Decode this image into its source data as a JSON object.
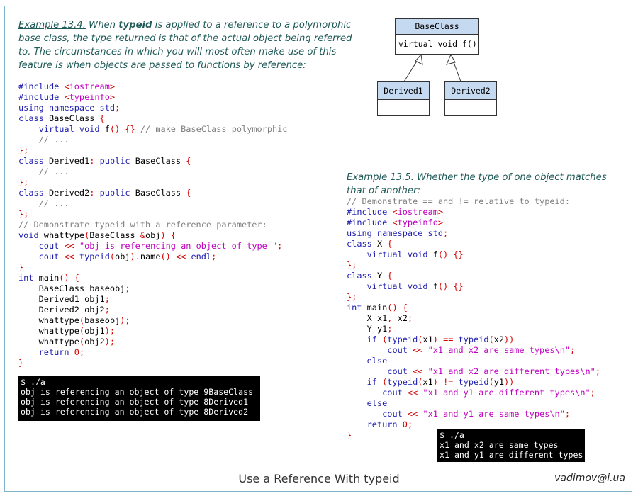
{
  "example1": {
    "label": "Example 13.4.",
    "text_a": " When ",
    "keyword": "typeid",
    "text_b": " is applied to a reference to a polymorphic base class, the type returned is that of the actual object being referred to. The circumstances in which you will most often make use of this feature is when objects are passed to functions by reference:"
  },
  "code1": [
    [
      [
        "#include ",
        "k"
      ],
      [
        "<",
        "p"
      ],
      [
        "iostream",
        "s"
      ],
      [
        ">",
        "p"
      ]
    ],
    [
      [
        "#include ",
        "k"
      ],
      [
        "<",
        "p"
      ],
      [
        "typeinfo",
        "s"
      ],
      [
        ">",
        "p"
      ]
    ],
    [
      [
        "using namespace std",
        "k"
      ],
      [
        ";",
        "p"
      ]
    ],
    [
      [
        "class ",
        "k"
      ],
      [
        "BaseClass ",
        ""
      ],
      [
        "{",
        "p"
      ]
    ],
    [
      [
        "    ",
        ""
      ],
      [
        "virtual void ",
        "k"
      ],
      [
        "f",
        ""
      ],
      [
        "() {} ",
        "p"
      ],
      [
        "// make BaseClass polymorphic",
        "c"
      ]
    ],
    [
      [
        "    ",
        ""
      ],
      [
        "// ...",
        "c"
      ]
    ],
    [
      [
        "};",
        "p"
      ]
    ],
    [
      [
        "class ",
        "k"
      ],
      [
        "Derived1",
        ""
      ],
      [
        ": ",
        "p"
      ],
      [
        "public ",
        "k"
      ],
      [
        "BaseClass ",
        ""
      ],
      [
        "{",
        "p"
      ]
    ],
    [
      [
        "    ",
        ""
      ],
      [
        "// ...",
        "c"
      ]
    ],
    [
      [
        "};",
        "p"
      ]
    ],
    [
      [
        "class ",
        "k"
      ],
      [
        "Derived2",
        ""
      ],
      [
        ": ",
        "p"
      ],
      [
        "public ",
        "k"
      ],
      [
        "BaseClass ",
        ""
      ],
      [
        "{",
        "p"
      ]
    ],
    [
      [
        "    ",
        ""
      ],
      [
        "// ...",
        "c"
      ]
    ],
    [
      [
        "};",
        "p"
      ]
    ],
    [
      [
        "// Demonstrate typeid with a reference parameter:",
        "c"
      ]
    ],
    [
      [
        "void ",
        "k"
      ],
      [
        "whattype",
        ""
      ],
      [
        "(",
        "p"
      ],
      [
        "BaseClass ",
        ""
      ],
      [
        "&",
        "p"
      ],
      [
        "obj",
        ""
      ],
      [
        ") {",
        "p"
      ]
    ],
    [
      [
        "    ",
        ""
      ],
      [
        "cout ",
        "k"
      ],
      [
        "<< ",
        "p"
      ],
      [
        "\"obj is referencing an object of type \"",
        "s"
      ],
      [
        ";",
        "p"
      ]
    ],
    [
      [
        "    ",
        ""
      ],
      [
        "cout ",
        "k"
      ],
      [
        "<< ",
        "p"
      ],
      [
        "typeid",
        "k"
      ],
      [
        "(",
        "p"
      ],
      [
        "obj",
        ""
      ],
      [
        ").",
        "p"
      ],
      [
        "name",
        ""
      ],
      [
        "() << ",
        "p"
      ],
      [
        "endl",
        "k"
      ],
      [
        ";",
        "p"
      ]
    ],
    [
      [
        "}",
        "p"
      ]
    ],
    [
      [
        "int ",
        "k"
      ],
      [
        "main",
        ""
      ],
      [
        "() {",
        "p"
      ]
    ],
    [
      [
        "    BaseClass baseobj",
        ""
      ],
      [
        ";",
        "p"
      ]
    ],
    [
      [
        "    Derived1 obj1",
        ""
      ],
      [
        ";",
        "p"
      ]
    ],
    [
      [
        "    Derived2 obj2",
        ""
      ],
      [
        ";",
        "p"
      ]
    ],
    [
      [
        "    whattype",
        ""
      ],
      [
        "(",
        "p"
      ],
      [
        "baseobj",
        ""
      ],
      [
        ");",
        "p"
      ]
    ],
    [
      [
        "    whattype",
        ""
      ],
      [
        "(",
        "p"
      ],
      [
        "obj1",
        ""
      ],
      [
        ");",
        "p"
      ]
    ],
    [
      [
        "    whattype",
        ""
      ],
      [
        "(",
        "p"
      ],
      [
        "obj2",
        ""
      ],
      [
        ");",
        "p"
      ]
    ],
    [
      [
        "    ",
        ""
      ],
      [
        "return ",
        "k"
      ],
      [
        "0",
        "p"
      ],
      [
        ";",
        "p"
      ]
    ],
    [
      [
        "}",
        "p"
      ]
    ]
  ],
  "terminal1": [
    "$ ./a",
    "obj is referencing an object of type 9BaseClass",
    "obj is referencing an object of type 8Derived1",
    "obj is referencing an object of type 8Derived2"
  ],
  "uml": {
    "base_name": "BaseClass",
    "base_method": "virtual void f()",
    "derived1": "Derived1",
    "derived2": "Derived2"
  },
  "example2": {
    "label": "Example 13.5.",
    "text": " Whether the type of one object matches that of another:"
  },
  "code2": [
    [
      [
        "// Demonstrate == and != relative to typeid:",
        "c"
      ]
    ],
    [
      [
        "#include ",
        "k"
      ],
      [
        "<",
        "p"
      ],
      [
        "iostream",
        "s"
      ],
      [
        ">",
        "p"
      ]
    ],
    [
      [
        "#include ",
        "k"
      ],
      [
        "<",
        "p"
      ],
      [
        "typeinfo",
        "s"
      ],
      [
        ">",
        "p"
      ]
    ],
    [
      [
        "using namespace std",
        "k"
      ],
      [
        ";",
        "p"
      ]
    ],
    [
      [
        "class ",
        "k"
      ],
      [
        "X ",
        ""
      ],
      [
        "{",
        "p"
      ]
    ],
    [
      [
        "    ",
        ""
      ],
      [
        "virtual void ",
        "k"
      ],
      [
        "f",
        ""
      ],
      [
        "() {}",
        "p"
      ]
    ],
    [
      [
        "};",
        "p"
      ]
    ],
    [
      [
        "class ",
        "k"
      ],
      [
        "Y ",
        ""
      ],
      [
        "{",
        "p"
      ]
    ],
    [
      [
        "    ",
        ""
      ],
      [
        "virtual void ",
        "k"
      ],
      [
        "f",
        ""
      ],
      [
        "() {}",
        "p"
      ]
    ],
    [
      [
        "};",
        "p"
      ]
    ],
    [
      [
        "int ",
        "k"
      ],
      [
        "main",
        ""
      ],
      [
        "() {",
        "p"
      ]
    ],
    [
      [
        "    X x1",
        ""
      ],
      [
        ", ",
        "p"
      ],
      [
        "x2",
        ""
      ],
      [
        ";",
        "p"
      ]
    ],
    [
      [
        "    Y y1",
        ""
      ],
      [
        ";",
        "p"
      ]
    ],
    [
      [
        "    ",
        ""
      ],
      [
        "if ",
        "k"
      ],
      [
        "(",
        "p"
      ],
      [
        "typeid",
        "k"
      ],
      [
        "(",
        "p"
      ],
      [
        "x1",
        ""
      ],
      [
        ") == ",
        "p"
      ],
      [
        "typeid",
        "k"
      ],
      [
        "(",
        "p"
      ],
      [
        "x2",
        ""
      ],
      [
        "))",
        "p"
      ]
    ],
    [
      [
        "        ",
        ""
      ],
      [
        "cout ",
        "k"
      ],
      [
        "<< ",
        "p"
      ],
      [
        "\"x1 and x2 are same types\\n\"",
        "s"
      ],
      [
        ";",
        "p"
      ]
    ],
    [
      [
        "    ",
        ""
      ],
      [
        "else",
        "k"
      ]
    ],
    [
      [
        "        ",
        ""
      ],
      [
        "cout ",
        "k"
      ],
      [
        "<< ",
        "p"
      ],
      [
        "\"x1 and x2 are different types\\n\"",
        "s"
      ],
      [
        ";",
        "p"
      ]
    ],
    [
      [
        "    ",
        ""
      ],
      [
        "if ",
        "k"
      ],
      [
        "(",
        "p"
      ],
      [
        "typeid",
        "k"
      ],
      [
        "(",
        "p"
      ],
      [
        "x1",
        ""
      ],
      [
        ") != ",
        "p"
      ],
      [
        "typeid",
        "k"
      ],
      [
        "(",
        "p"
      ],
      [
        "y1",
        ""
      ],
      [
        "))",
        "p"
      ]
    ],
    [
      [
        "       ",
        ""
      ],
      [
        "cout ",
        "k"
      ],
      [
        "<< ",
        "p"
      ],
      [
        "\"x1 and y1 are different types\\n\"",
        "s"
      ],
      [
        ";",
        "p"
      ]
    ],
    [
      [
        "    ",
        ""
      ],
      [
        "else",
        "k"
      ]
    ],
    [
      [
        "       ",
        ""
      ],
      [
        "cout ",
        "k"
      ],
      [
        "<< ",
        "p"
      ],
      [
        "\"x1 and y1 are same types\\n\"",
        "s"
      ],
      [
        ";",
        "p"
      ]
    ],
    [
      [
        "    ",
        ""
      ],
      [
        "return ",
        "k"
      ],
      [
        "0",
        "p"
      ],
      [
        ";",
        "p"
      ]
    ],
    [
      [
        "}",
        "p"
      ]
    ]
  ],
  "terminal2": [
    "$ ./a",
    "x1 and x2 are same types",
    "x1 and y1 are different types"
  ],
  "footer": {
    "title": "Use a Reference With typeid",
    "email": "vadimov@i.ua"
  }
}
